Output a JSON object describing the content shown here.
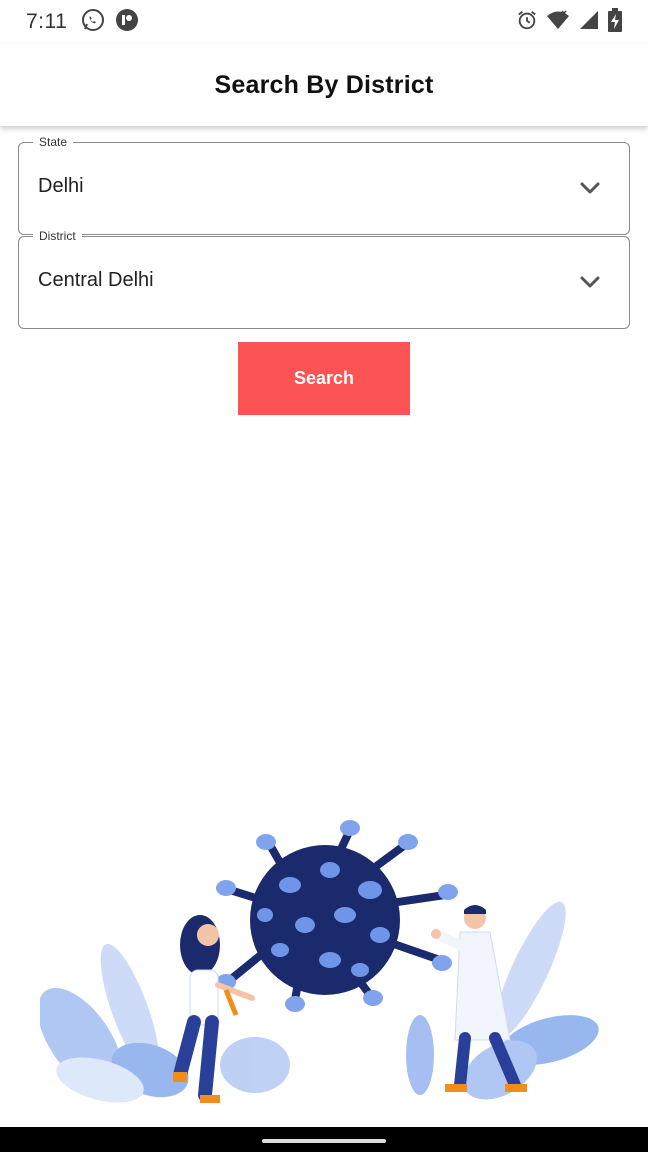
{
  "status_bar": {
    "time": "7:11",
    "left_icons": [
      "whatsapp-icon",
      "app-notification-icon"
    ],
    "right_icons": [
      "alarm-icon",
      "wifi-icon",
      "signal-icon",
      "battery-charging-icon"
    ]
  },
  "app_bar": {
    "title": "Search By District"
  },
  "form": {
    "state": {
      "label": "State",
      "value": "Delhi"
    },
    "district": {
      "label": "District",
      "value": "Central Delhi"
    },
    "search_label": "Search"
  },
  "colors": {
    "accent": "#fc5454",
    "virus": "#1a2a6c",
    "foliage": "#8fb0ee"
  },
  "illustration": {
    "icon": "virus-doctors-illustration"
  }
}
